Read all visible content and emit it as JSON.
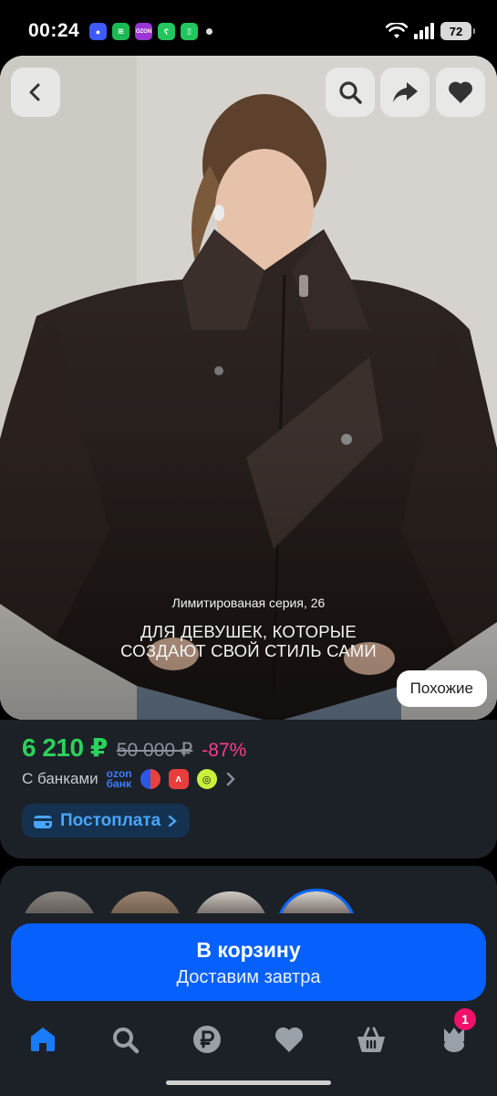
{
  "status_bar": {
    "time": "00:24",
    "battery": "72",
    "apps": [
      {
        "icon": "max-icon",
        "color": "#3e5bff",
        "glyph": "●"
      },
      {
        "icon": "spotify-icon",
        "color": "#1db954",
        "glyph": "≋"
      },
      {
        "icon": "ozon-icon",
        "color": "#9b36d6",
        "glyph": "OZON"
      },
      {
        "icon": "bear-app-icon",
        "color": "#22c55e",
        "glyph": "ʕ"
      },
      {
        "icon": "phone-cleaner-icon",
        "color": "#22c55e",
        "glyph": "▯"
      }
    ]
  },
  "hero": {
    "caption": "Лимитированая серия, 26",
    "headline_line1": "ДЛЯ ДЕВУШЕК, КОТОРЫЕ",
    "headline_line2": "СОЗДАЮТ СВОЙ СТИЛЬ САМИ",
    "similar_label": "Похожие",
    "back_icon": "back-arrow-icon",
    "search_icon": "search-icon",
    "share_icon": "share-icon",
    "favorite_icon": "heart-icon"
  },
  "product": {
    "price": "6 210 ₽",
    "old_price": "50 000 ₽",
    "discount": "-87%",
    "banks_label": "С банками",
    "ozon_bank_line1": "ozon",
    "ozon_bank_line2": "банк",
    "postpay_label": "Постоплата"
  },
  "cart": {
    "title": "В корзину",
    "subtitle": "Доставим завтра"
  },
  "nav": {
    "items": [
      "home-icon",
      "search-icon",
      "ruble-icon",
      "heart-icon",
      "basket-icon",
      "profile-icon"
    ],
    "badge": "1"
  },
  "colors": {
    "accent": "#0560fc",
    "price": "#2bd25a",
    "discount": "#ff3b8d",
    "panel": "#1c2128"
  }
}
